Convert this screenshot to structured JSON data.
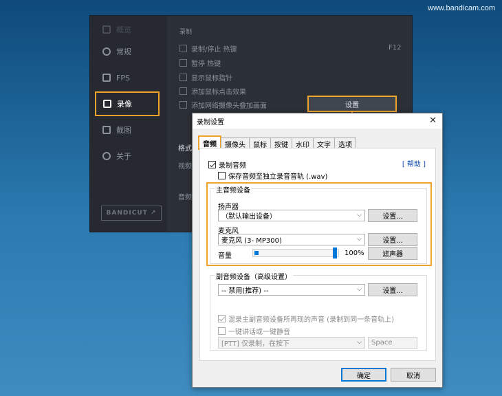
{
  "watermark": "www.bandicam.com",
  "app": {
    "sidebar": [
      {
        "label": "概览",
        "key": "overview"
      },
      {
        "label": "常规",
        "key": "general"
      },
      {
        "label": "FPS",
        "key": "fps"
      },
      {
        "label": "录像",
        "key": "record"
      },
      {
        "label": "截图",
        "key": "image"
      },
      {
        "label": "关于",
        "key": "about"
      }
    ],
    "bandicut": "BANDICUT ↗",
    "section_label": "录制",
    "hotkey_value": "F12",
    "options": [
      {
        "label": "录制/停止 热键",
        "checked": true
      },
      {
        "label": "暂停 热键",
        "checked": false
      },
      {
        "label": "显示鼠标指针",
        "checked": false
      },
      {
        "label": "添加鼠标点击效果",
        "checked": false
      },
      {
        "label": "添加网络摄像头叠加画面",
        "checked": false
      }
    ],
    "settings_button": "设置",
    "format_label": "格式",
    "video_label": "视频",
    "audio_label": "音频"
  },
  "dialog": {
    "title": "录制设置",
    "close": "✕",
    "tabs": [
      "音频",
      "摄像头",
      "鼠标",
      "按键",
      "水印",
      "文字",
      "选项"
    ],
    "active_tab": 0,
    "help": "[ 帮助 ]",
    "record_audio": "录制音频",
    "save_separate": "保存音频至独立录音音轨 (.wav)",
    "primary_group": "主音频设备",
    "speaker_label": "扬声器",
    "speaker_value": "（默认输出设备）",
    "speaker_btn": "设置...",
    "mic_label": "麦克风",
    "mic_value": "麦克风 (3- MP300)",
    "mic_btn": "设置...",
    "volume_label": "音量",
    "volume_value": "100%",
    "volume_level": 1.0,
    "filter_btn": "滤声器",
    "secondary_group": "副音频设备（高级设置）",
    "secondary_value": "-- 禁用(推荐) --",
    "secondary_btn": "设置...",
    "mix_label": "混录主副音频设备所再现的声音 (录制到同一条音轨上)",
    "ptt_label": "一键讲话或一键静音",
    "ptt_value": "[PTT] 仅录制，在按下",
    "ptt_key": "Space",
    "ok": "确定",
    "cancel": "取消"
  },
  "colors": {
    "accent_orange": "#f0a32a",
    "link_blue": "#0645ad",
    "slider_blue": "#0078d7"
  }
}
